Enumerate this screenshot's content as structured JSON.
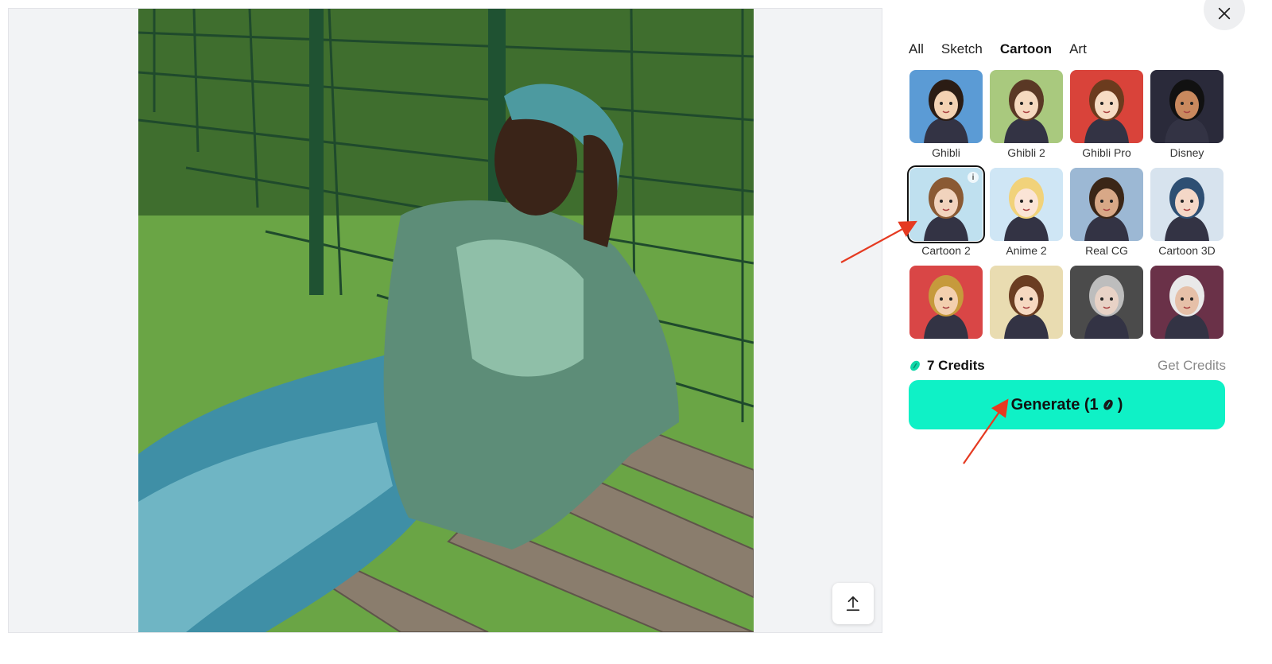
{
  "tabs": [
    {
      "label": "All",
      "active": false
    },
    {
      "label": "Sketch",
      "active": false
    },
    {
      "label": "Cartoon",
      "active": true
    },
    {
      "label": "Art",
      "active": false
    }
  ],
  "styles": [
    {
      "label": "Ghibli",
      "bg": "#5b9bd5",
      "skin": "#f3d2b3",
      "hair": "#2b1c14",
      "selected": false
    },
    {
      "label": "Ghibli 2",
      "bg": "#a9c97e",
      "skin": "#f5d9bf",
      "hair": "#5a3825",
      "selected": false
    },
    {
      "label": "Ghibli Pro",
      "bg": "#d9433a",
      "skin": "#f7dcc4",
      "hair": "#6b3b1e",
      "selected": false
    },
    {
      "label": "Disney",
      "bg": "#2a2a3a",
      "skin": "#c9895e",
      "hair": "#111111",
      "selected": false
    },
    {
      "label": "Cartoon 2",
      "bg": "#bfe0ef",
      "skin": "#f1d3bd",
      "hair": "#8a5a34",
      "selected": true
    },
    {
      "label": "Anime 2",
      "bg": "#cfe6f5",
      "skin": "#fbe4d6",
      "hair": "#f1d27a",
      "selected": false
    },
    {
      "label": "Real CG",
      "bg": "#9cb8d4",
      "skin": "#d8a887",
      "hair": "#3b2617",
      "selected": false
    },
    {
      "label": "Cartoon 3D",
      "bg": "#d7e3ee",
      "skin": "#f4d7c7",
      "hair": "#2e4f73",
      "selected": false
    },
    {
      "label": "",
      "bg": "#d94646",
      "skin": "#f3cfae",
      "hair": "#c69a3c",
      "selected": false
    },
    {
      "label": "",
      "bg": "#e9dcb1",
      "skin": "#f6d8c0",
      "hair": "#6b3d22",
      "selected": false
    },
    {
      "label": "",
      "bg": "#4b4b4b",
      "skin": "#e8d2c6",
      "hair": "#bdbdbd",
      "selected": false
    },
    {
      "label": "",
      "bg": "#6a3148",
      "skin": "#e6c0a8",
      "hair": "#e9e9e9",
      "selected": false
    }
  ],
  "credits": {
    "text": "7 Credits",
    "get_label": "Get Credits",
    "icon": "bean-icon",
    "color": "#0fd7a8"
  },
  "generate": {
    "label": "Generate (1",
    "suffix": ")",
    "color": "#0ff1c6"
  },
  "accent_arrow_color": "#e53a21"
}
